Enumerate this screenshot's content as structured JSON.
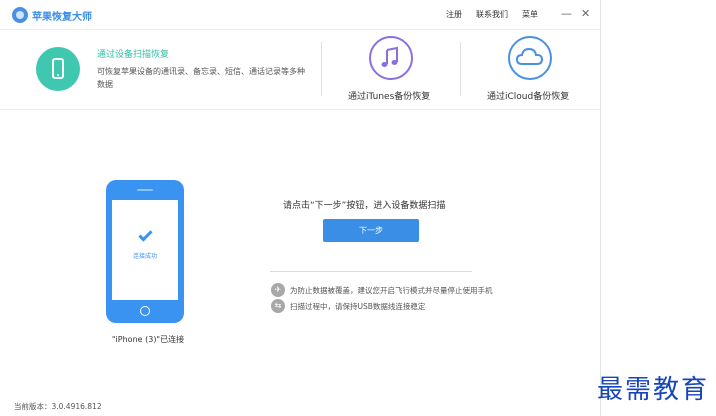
{
  "app": {
    "title": "苹果恢复大师",
    "brand_color": "#3a8ee6"
  },
  "titlebar": {
    "register_label": "注册",
    "contact_label": "联系我们",
    "menu_label": "菜单",
    "minimize_glyph": "—",
    "close_glyph": "✕"
  },
  "modes": [
    {
      "title": "通过设备扫描恢复",
      "description": "可恢复苹果设备的通讯录、备忘录、短信、通话记录等多种数据",
      "icon": "phone-icon",
      "color": "#3fc7b0",
      "active": true
    },
    {
      "label": "通过iTunes备份恢复",
      "icon": "music-note-icon",
      "color": "#8b6fdf",
      "active": false
    },
    {
      "label": "通过iCloud备份恢复",
      "icon": "cloud-icon",
      "color": "#4a90e2",
      "active": false
    }
  ],
  "device": {
    "screen_text": "连接成功",
    "label": "\"iPhone (3)\"已连接",
    "icon": "check-icon"
  },
  "main": {
    "prompt": "请点击“下一步”按钮，进入设备数据扫描",
    "next_button": "下一步",
    "tips": [
      {
        "icon": "airplane-icon",
        "text": "为防止数据被覆盖，建议您开启飞行模式并尽量停止使用手机"
      },
      {
        "icon": "link-icon",
        "text": "扫描过程中，请保持USB数据线连接稳定"
      }
    ]
  },
  "footer": {
    "version": "当前版本：3.0.4916.812"
  },
  "watermark": "最需教育"
}
